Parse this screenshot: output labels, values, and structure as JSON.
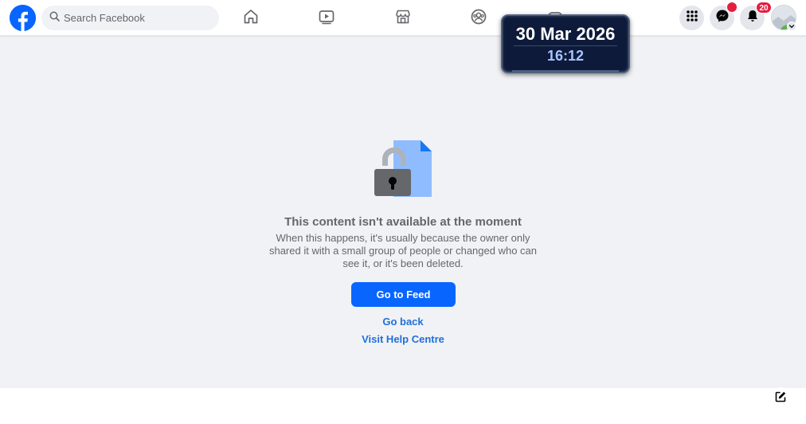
{
  "header": {
    "logo_icon": "facebook-logo-icon",
    "search": {
      "placeholder": "Search Facebook",
      "icon": "search-icon"
    },
    "nav_tabs": [
      {
        "name": "home",
        "icon": "home-icon"
      },
      {
        "name": "watch",
        "icon": "video-icon"
      },
      {
        "name": "marketplace",
        "icon": "marketplace-icon"
      },
      {
        "name": "groups",
        "icon": "groups-icon"
      },
      {
        "name": "gaming",
        "icon": "gaming-icon"
      }
    ],
    "actions": {
      "menu_icon": "grid-menu-icon",
      "messenger_icon": "messenger-icon",
      "notifications_icon": "bell-icon",
      "notifications_count": "20",
      "profile_icon": "avatar"
    }
  },
  "clock_widget": {
    "date": "30 Mar 2026",
    "time": "16:12"
  },
  "content": {
    "illustration_icon": "lock-document-icon",
    "title": "This content isn't available at the moment",
    "body": "When this happens, it's usually because the owner only shared it with a small group of people or changed who can see it, or it's been deleted.",
    "primary_button": "Go to Feed",
    "links": {
      "back": "Go back",
      "help": "Visit Help Centre"
    }
  },
  "footer": {
    "compose_icon": "compose-icon"
  },
  "colors": {
    "brand_blue": "#0866ff",
    "link_blue": "#216fdb",
    "page_bg": "#f0f2f5",
    "badge_red": "#e41e3f",
    "muted_text": "#65676b"
  }
}
